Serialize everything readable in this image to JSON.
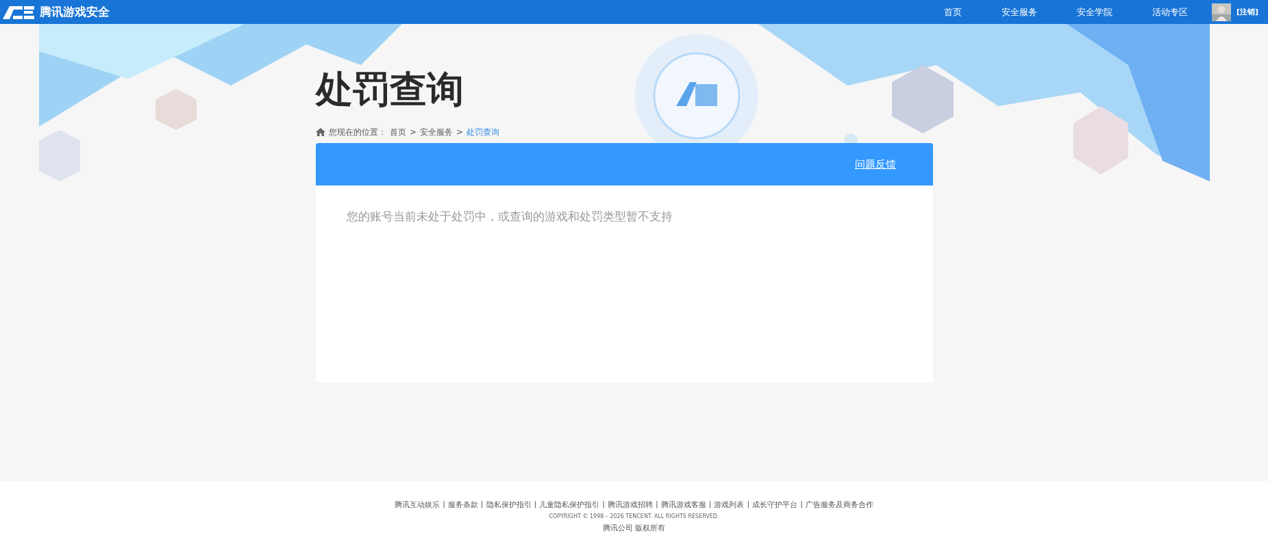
{
  "header": {
    "brand": "腾讯游戏安全",
    "nav": [
      {
        "label": "首页"
      },
      {
        "label": "安全服务"
      },
      {
        "label": "安全学院"
      },
      {
        "label": "活动专区"
      }
    ],
    "logout": "[注销]"
  },
  "page": {
    "title": "处罚查询",
    "breadcrumb": {
      "prefix": "您现在的位置：",
      "separator": ">",
      "items": [
        {
          "label": "首页",
          "selected": false
        },
        {
          "label": "安全服务",
          "selected": false
        },
        {
          "label": "处罚查询",
          "selected": true
        }
      ]
    }
  },
  "panel": {
    "feedback_link": "问题反馈",
    "message": "您的账号当前未处于处罚中，或查询的游戏和处罚类型暂不支持"
  },
  "footer": {
    "separator": "|",
    "links": [
      "腾讯互动娱乐",
      "服务条款",
      "隐私保护指引",
      "儿童隐私保护指引",
      "腾讯游戏招聘",
      "腾讯游戏客服",
      "游戏列表",
      "成长守护平台",
      "广告服务及商务合作"
    ],
    "copyright": "COPYRIGHT © 1998 – 2026 TENCENT. ALL RIGHTS RESERVED.",
    "company": "腾讯公司 版权所有"
  }
}
